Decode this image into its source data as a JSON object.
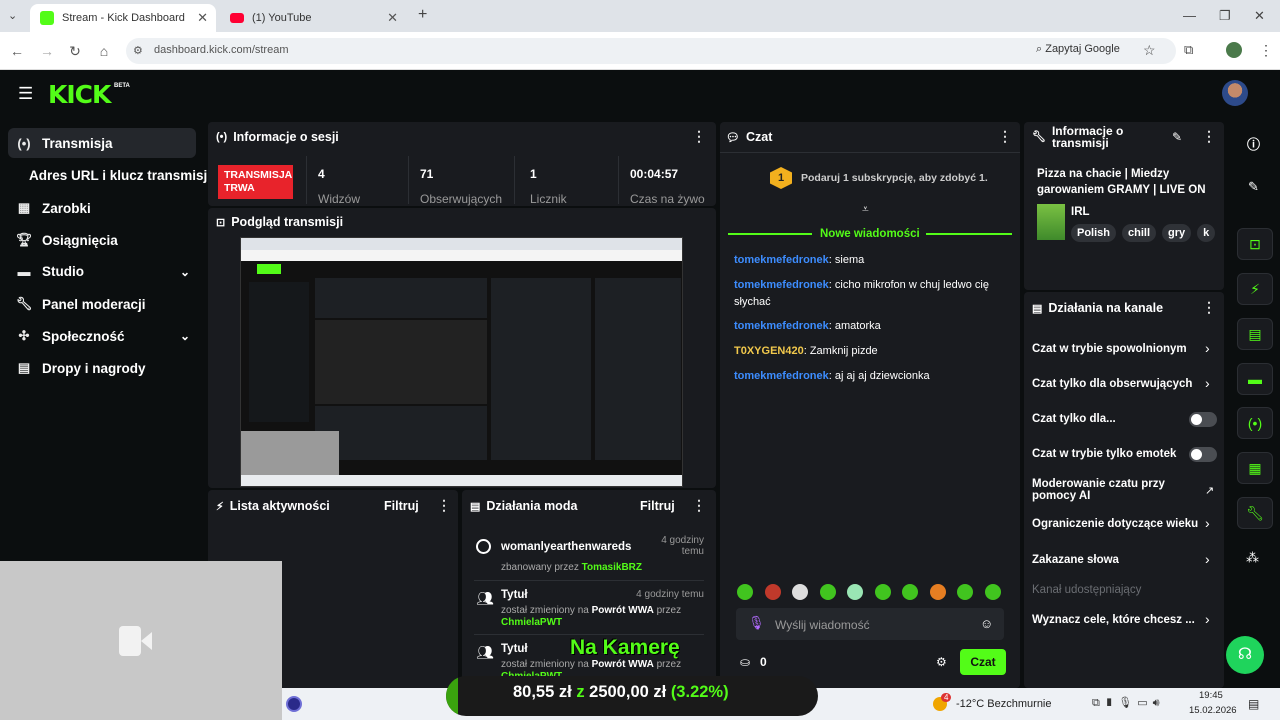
{
  "browser": {
    "tabs": [
      {
        "title": "Stream - Kick Dashboard",
        "active": true
      },
      {
        "title": "(1) YouTube",
        "active": false
      }
    ],
    "url": "dashboard.kick.com/stream",
    "google_label": "Zapytaj Google"
  },
  "kick": {
    "logo": "KICK",
    "beta": "BETA"
  },
  "sidebar": {
    "items": [
      {
        "label": "Transmisja",
        "icon": "broadcast-icon"
      },
      {
        "label": "Adres URL i klucz transmisji",
        "icon": ""
      },
      {
        "label": "Zarobki",
        "icon": "chart-icon"
      },
      {
        "label": "Osiągnięcia",
        "icon": "trophy-icon"
      },
      {
        "label": "Studio",
        "icon": "studio-icon"
      },
      {
        "label": "Panel moderacji",
        "icon": "wrench-icon"
      },
      {
        "label": "Społeczność",
        "icon": "community-icon"
      },
      {
        "label": "Dropy i nagrody",
        "icon": "gift-icon"
      }
    ]
  },
  "session": {
    "title": "Informacje o sesji",
    "status": "TRANSMISJA TRWA",
    "stats": [
      {
        "value": "4",
        "label": "Widzów"
      },
      {
        "value": "71",
        "label": "Obserwujących"
      },
      {
        "value": "1",
        "label": "Licznik"
      },
      {
        "value": "00:04:57",
        "label": "Czas na żywo"
      }
    ]
  },
  "preview": {
    "title": "Podgląd transmisji"
  },
  "activity": {
    "title": "Lista aktywności",
    "filter": "Filtruj"
  },
  "modactions": {
    "title": "Działania moda",
    "filter": "Filtruj",
    "rows": [
      {
        "title": "womanlyearthenwareds",
        "time": "4 godziny temu",
        "sub1": "zbanowany przez",
        "user1": "TomasikBRZ",
        "sub2": "",
        "user2": ""
      },
      {
        "title": "Tytuł",
        "time": "4 godziny temu",
        "sub1": "został zmieniony na",
        "user1": "Powrót WWA",
        "sub2": "przez",
        "user2": "ChmielaPWT"
      },
      {
        "title": "Tytuł",
        "time": "",
        "sub1": "został zmieniony na",
        "user1": "Powrót WWA",
        "sub2": "przez",
        "user2": "ChmielaPWT"
      }
    ]
  },
  "chat": {
    "title": "Czat",
    "sub_prompt": "Podaruj 1 subskrypcję, aby zdobyć 1.",
    "sub_badge": "1",
    "new_messages": "Nowe wiadomości",
    "messages": [
      {
        "user": "tomekmefedronek",
        "text": ": siema",
        "color": "#3d8dff"
      },
      {
        "user": "tomekmefedronek",
        "text": ": cicho mikrofon w chuj ledwo cię słychać",
        "color": "#3d8dff"
      },
      {
        "user": "tomekmefedronek",
        "text": ": amatorka",
        "color": "#3d8dff"
      },
      {
        "user": "T0XYGEN420",
        "text": ": Zamknij pizde",
        "color": "#f2c94c"
      },
      {
        "user": "tomekmefedronek",
        "text": ": aj aj aj dziewcionka",
        "color": "#3d8dff"
      }
    ],
    "placeholder": "Wyślij wiadomość",
    "points": "0",
    "send": "Czat"
  },
  "streaminfo": {
    "title": "Informacje o transmisji",
    "stream_title": "Pizza na chacie | Miedzy garowaniem GRAMY | LIVE ON",
    "category": "IRL",
    "tags": [
      "Polish",
      "chill",
      "gry",
      "k"
    ]
  },
  "channel_actions": {
    "title": "Działania na kanale",
    "rows": [
      {
        "label": "Czat w trybie spowolnionym",
        "type": "arrow"
      },
      {
        "label": "Czat tylko dla obserwujących",
        "type": "arrow"
      },
      {
        "label": "Czat tylko dla...",
        "type": "toggle"
      },
      {
        "label": "Czat w trybie tylko emotek",
        "type": "toggle"
      },
      {
        "label": "Moderowanie czatu przy pomocy AI",
        "type": "external"
      },
      {
        "label": "Ograniczenie dotyczące wieku",
        "type": "arrow"
      },
      {
        "label": "Zakazane słowa",
        "type": "arrow"
      },
      {
        "label": "Kanał udostępniający",
        "type": "disabled"
      },
      {
        "label": "Wyznacz cele, które chcesz ...",
        "type": "arrow"
      }
    ]
  },
  "overlay": {
    "camera_text": "Na Kamerę",
    "goal_current": "80,55 zł",
    "goal_z": "z",
    "goal_target": "2500,00 zł",
    "goal_pct": "(3.22%)"
  },
  "taskbar": {
    "weather": "-12°C Bezchmurnie",
    "time": "19:45",
    "date": "15.02.2026",
    "notif_badge": "4"
  },
  "colors": {
    "kick_green": "#53fc18",
    "live_red": "#e8232b",
    "panel": "#191b1f"
  }
}
